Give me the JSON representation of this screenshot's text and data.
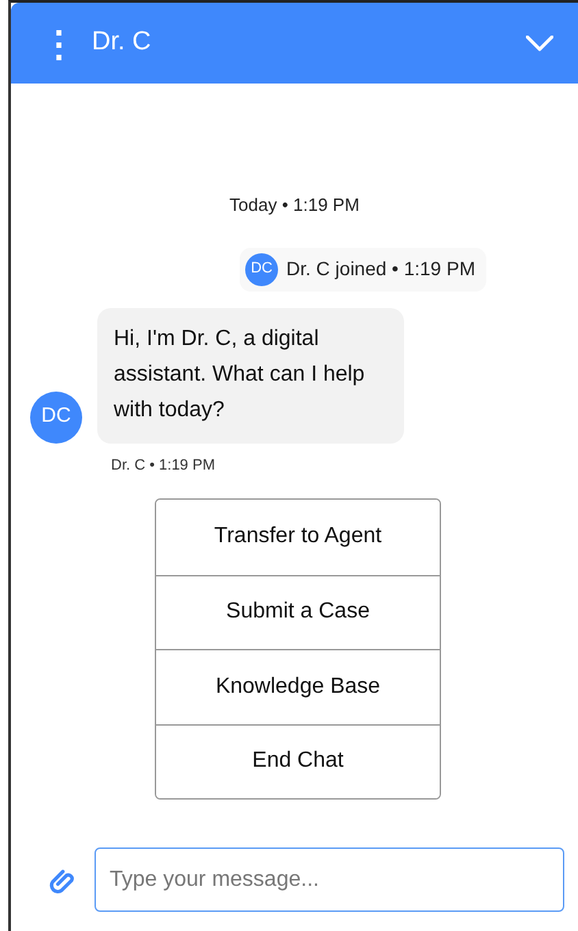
{
  "header": {
    "title": "Dr. C",
    "menu_icon": "⋮"
  },
  "chat": {
    "date_stamp": "Today • 1:19 PM",
    "join_notice": {
      "avatar": "DC",
      "text": "Dr. C joined • 1:19 PM"
    },
    "message": {
      "avatar": "DC",
      "text": "Hi, I'm Dr. C, a digital assistant. What can I help with today?",
      "meta": "Dr. C • 1:19 PM"
    },
    "options": [
      "Transfer to Agent",
      "Submit a Case",
      "Knowledge Base",
      "End Chat"
    ]
  },
  "composer": {
    "placeholder": "Type your message..."
  }
}
